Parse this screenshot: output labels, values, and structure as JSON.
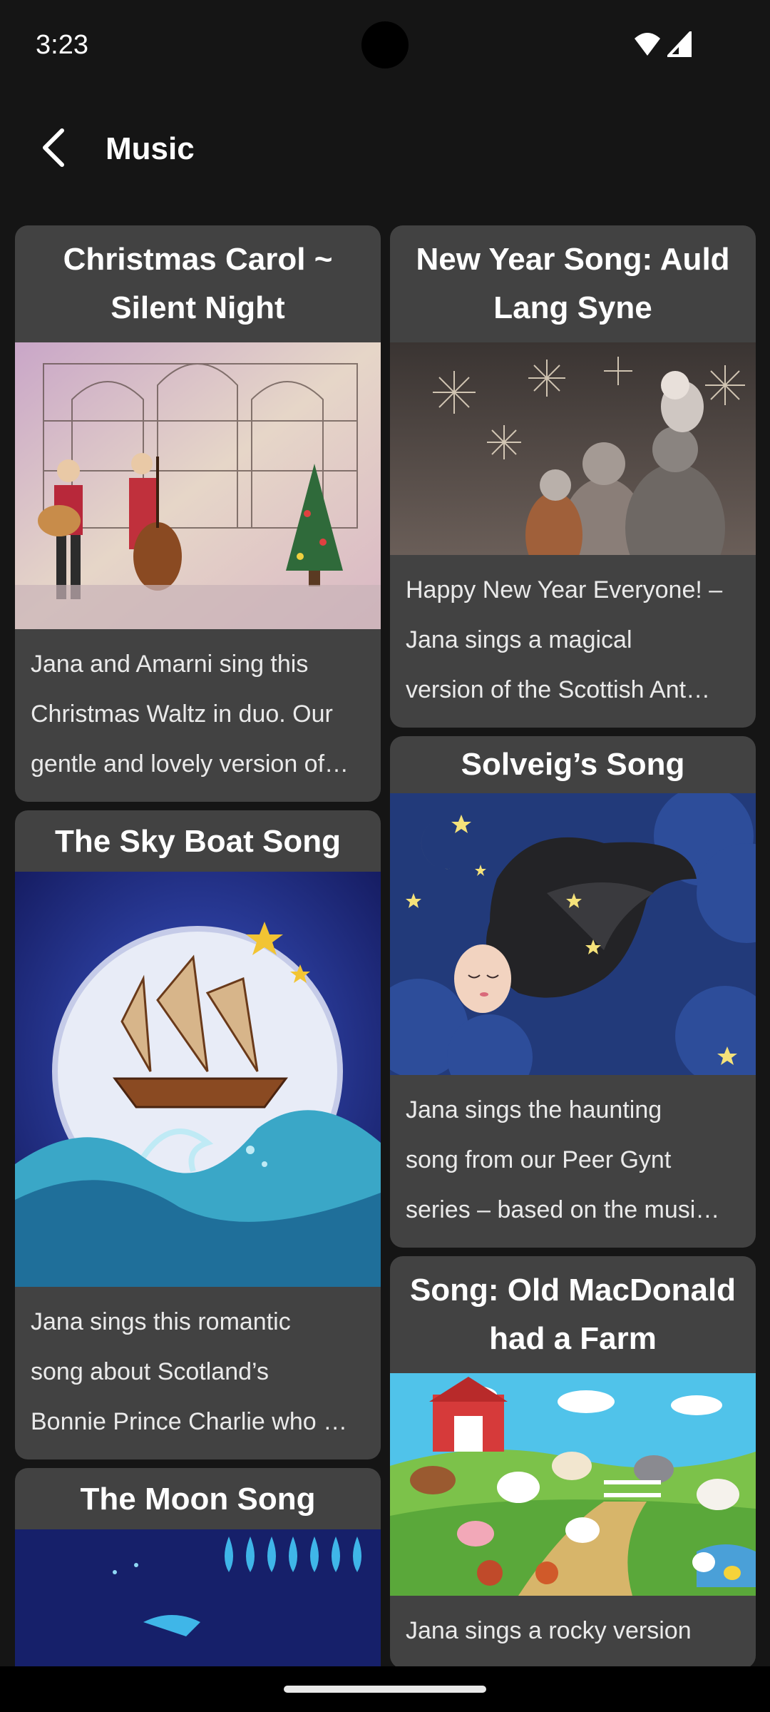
{
  "status": {
    "time": "3:23"
  },
  "app_bar": {
    "title": "Music",
    "back_icon": "back-arrow-icon"
  },
  "cards": {
    "christmas": {
      "title": "Christmas Carol ~ Silent Night",
      "desc": [
        "Jana and Amarni sing this",
        "Christmas Waltz in duo. Our",
        "gentle and lovely version of…"
      ]
    },
    "newyear": {
      "title": "New Year Song: Auld Lang Syne",
      "desc": [
        "Happy New Year Everyone! –",
        "Jana sings a magical",
        "version of the Scottish Ant…"
      ]
    },
    "solveig": {
      "title": "Solveig’s Song",
      "desc": [
        "Jana sings the haunting",
        "song from our Peer Gynt",
        "series – based on the musi…"
      ]
    },
    "skyboat": {
      "title": "The Sky Boat Song",
      "desc": [
        "Jana sings this romantic",
        "song about Scotland’s",
        "Bonnie Prince Charlie who …"
      ]
    },
    "macdonald": {
      "title": "Song: Old MacDonald had a Farm",
      "desc": [
        "Jana sings a rocky version"
      ]
    },
    "moon": {
      "title": "The Moon Song"
    }
  }
}
